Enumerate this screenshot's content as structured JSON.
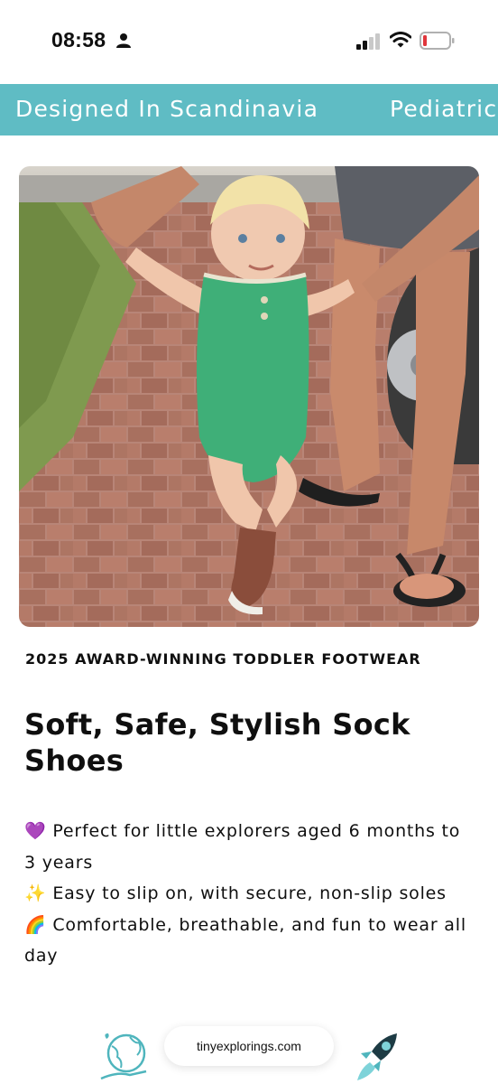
{
  "status_bar": {
    "time": "08:58",
    "icons": [
      "person-icon",
      "signal-icon",
      "wifi-icon",
      "battery-low-icon"
    ]
  },
  "announcement_bar": {
    "items": [
      "Designed In Scandinavia",
      "Pediatric"
    ],
    "background": "#5fbcc4"
  },
  "hero": {
    "alt": "Toddler in green romper and sock shoes walking on brick path holding adult hands"
  },
  "eyebrow": "2025 AWARD-WINNING TODDLER FOOTWEAR",
  "headline": "Soft, Safe, Stylish Sock Shoes",
  "benefits": [
    {
      "emoji": "💜",
      "text": "Perfect for little explorers aged 6 months to 3 years"
    },
    {
      "emoji": "✨",
      "text": "Easy to slip on, with secure, non-slip soles"
    },
    {
      "emoji": "🌈",
      "text": "Comfortable, breathable, and fun to wear all day"
    }
  ],
  "footer": {
    "url": "tinyexplorings.com",
    "icons": [
      "globe-hand-icon",
      "rocket-icon"
    ]
  },
  "colors": {
    "accent": "#5fbcc4",
    "text": "#0f0f0f",
    "battery_low": "#e0353b"
  }
}
